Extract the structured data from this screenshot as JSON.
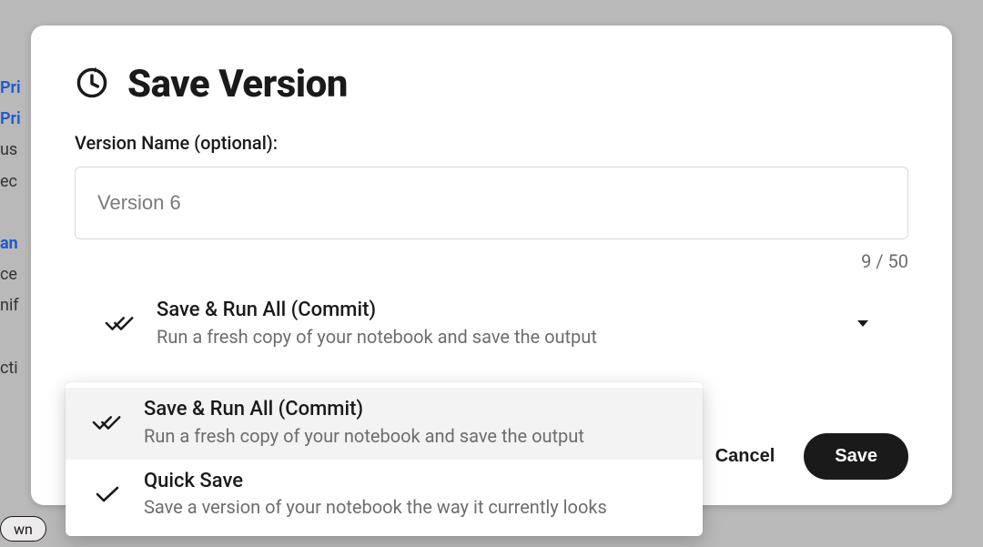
{
  "background": {
    "hints": [
      "Pri",
      "Pri",
      "us",
      "ec",
      "",
      "an",
      "ce",
      "nif",
      "",
      "cti"
    ],
    "pill": "wn"
  },
  "modal": {
    "title": "Save Version",
    "field_label": "Version Name (optional):",
    "input_value": "Version 6",
    "char_count": "9 / 50",
    "selected": {
      "title": "Save & Run All (Commit)",
      "subtitle": "Run a fresh copy of your notebook and save the output"
    },
    "options": [
      {
        "title": "Save & Run All (Commit)",
        "subtitle": "Run a fresh copy of your notebook and save the output",
        "selected": true,
        "icon": "double-check"
      },
      {
        "title": "Quick Save",
        "subtitle": "Save a version of your notebook the way it currently looks",
        "selected": false,
        "icon": "single-check"
      }
    ],
    "actions": {
      "cancel": "Cancel",
      "save": "Save"
    }
  }
}
